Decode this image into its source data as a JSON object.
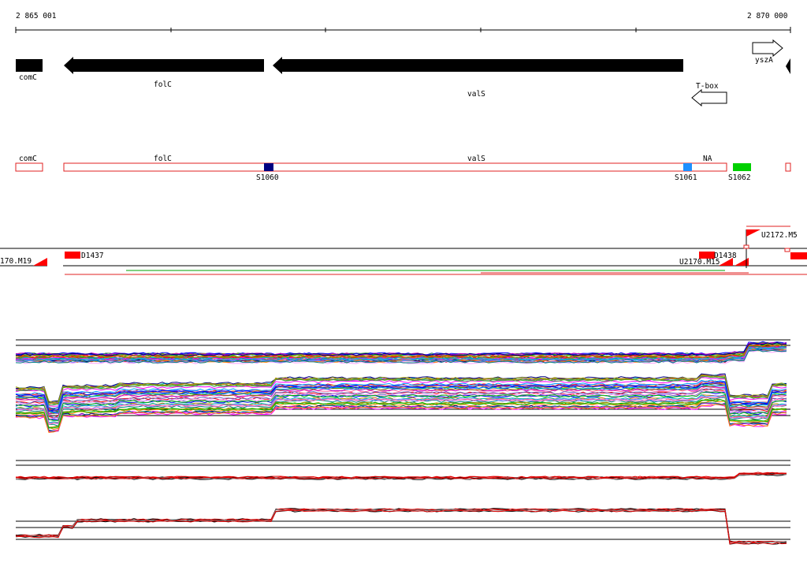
{
  "coordinates": {
    "start": "2 865 001",
    "end": "2 870 000"
  },
  "genes": [
    {
      "name": "comC",
      "strand": "-"
    },
    {
      "name": "folC",
      "strand": "-"
    },
    {
      "name": "valS",
      "strand": "-"
    },
    {
      "name": "T-box",
      "strand": "-"
    },
    {
      "name": "yszA",
      "strand": "+"
    }
  ],
  "segments": {
    "labels": [
      "comC",
      "folC",
      "valS",
      "NA"
    ],
    "markers": [
      {
        "id": "S1060",
        "color": "#000080"
      },
      {
        "id": "S1061",
        "color": "#1e90ff"
      },
      {
        "id": "S1062",
        "color": "#00d000"
      }
    ]
  },
  "features": {
    "labels": [
      "170.M19",
      "D1437",
      "D1438",
      "U2172.M5",
      "U2170.M15"
    ]
  },
  "colors": {
    "gene": "#000000",
    "segment_outline": "#e02020",
    "feature": "#ff0000",
    "feature_line": "#00a000"
  }
}
